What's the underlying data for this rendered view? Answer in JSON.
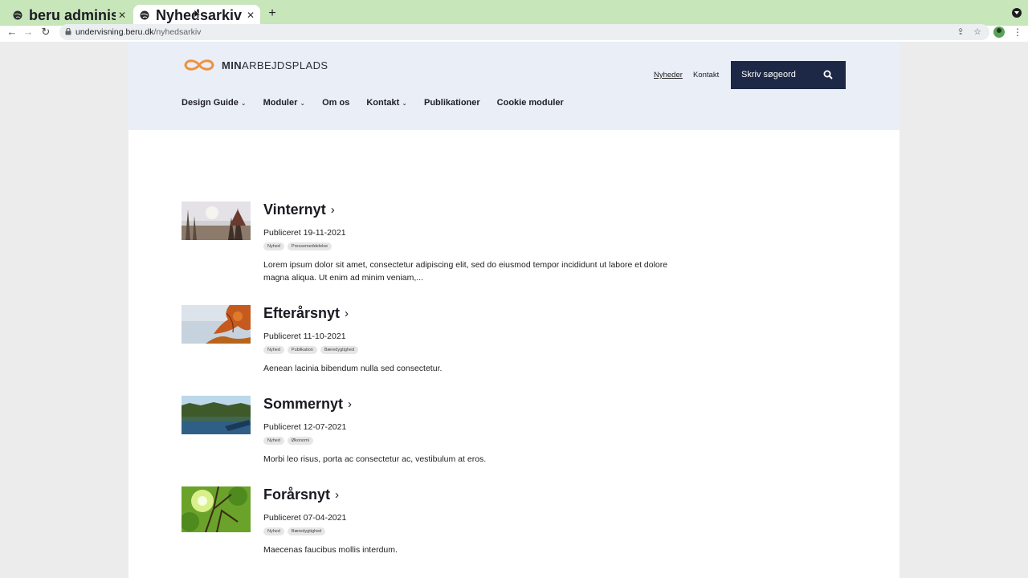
{
  "browser": {
    "tabs": [
      {
        "title": "beru administration",
        "active": false
      },
      {
        "title": "Nyhedsarkiv",
        "active": true
      }
    ],
    "url_domain": "undervisning.beru.dk",
    "url_path": "/nyhedsarkiv",
    "colors": {
      "tabbar": "#c7e6b9"
    }
  },
  "header": {
    "logo_bold": "MIN",
    "logo_light": "ARBEJDSPLADS",
    "utility_links": [
      "Nyheder",
      "Kontakt"
    ],
    "search_placeholder": "Skriv søgeord",
    "nav": [
      {
        "label": "Design Guide",
        "dropdown": true
      },
      {
        "label": "Moduler",
        "dropdown": true
      },
      {
        "label": "Om os",
        "dropdown": false
      },
      {
        "label": "Kontakt",
        "dropdown": true
      },
      {
        "label": "Publikationer",
        "dropdown": false
      },
      {
        "label": "Cookie moduler",
        "dropdown": false
      }
    ],
    "colors": {
      "header_bg": "#e9eef7",
      "search_bg": "#1d2746",
      "logo_accent": "#f0903a"
    }
  },
  "articles": [
    {
      "title": "Vinternyt",
      "date": "Publiceret 19-11-2021",
      "tags": [
        "Nyhed",
        "Pressemeddelelse"
      ],
      "excerpt": "Lorem ipsum dolor sit amet, consectetur adipiscing elit, sed do eiusmod tempor incididunt ut labore et dolore magna aliqua. Ut enim ad minim veniam,..."
    },
    {
      "title": "Efterårsnyt",
      "date": "Publiceret 11-10-2021",
      "tags": [
        "Nyhed",
        "Publikation",
        "Bæredygtighed"
      ],
      "excerpt": "Aenean lacinia bibendum nulla sed consectetur."
    },
    {
      "title": "Sommernyt",
      "date": "Publiceret 12-07-2021",
      "tags": [
        "Nyhed",
        "Økonomi"
      ],
      "excerpt": "Morbi leo risus, porta ac consectetur ac, vestibulum at eros."
    },
    {
      "title": "Forårsnyt",
      "date": "Publiceret 07-04-2021",
      "tags": [
        "Nyhed",
        "Bæredygtighed"
      ],
      "excerpt": "Maecenas faucibus mollis interdum."
    }
  ]
}
